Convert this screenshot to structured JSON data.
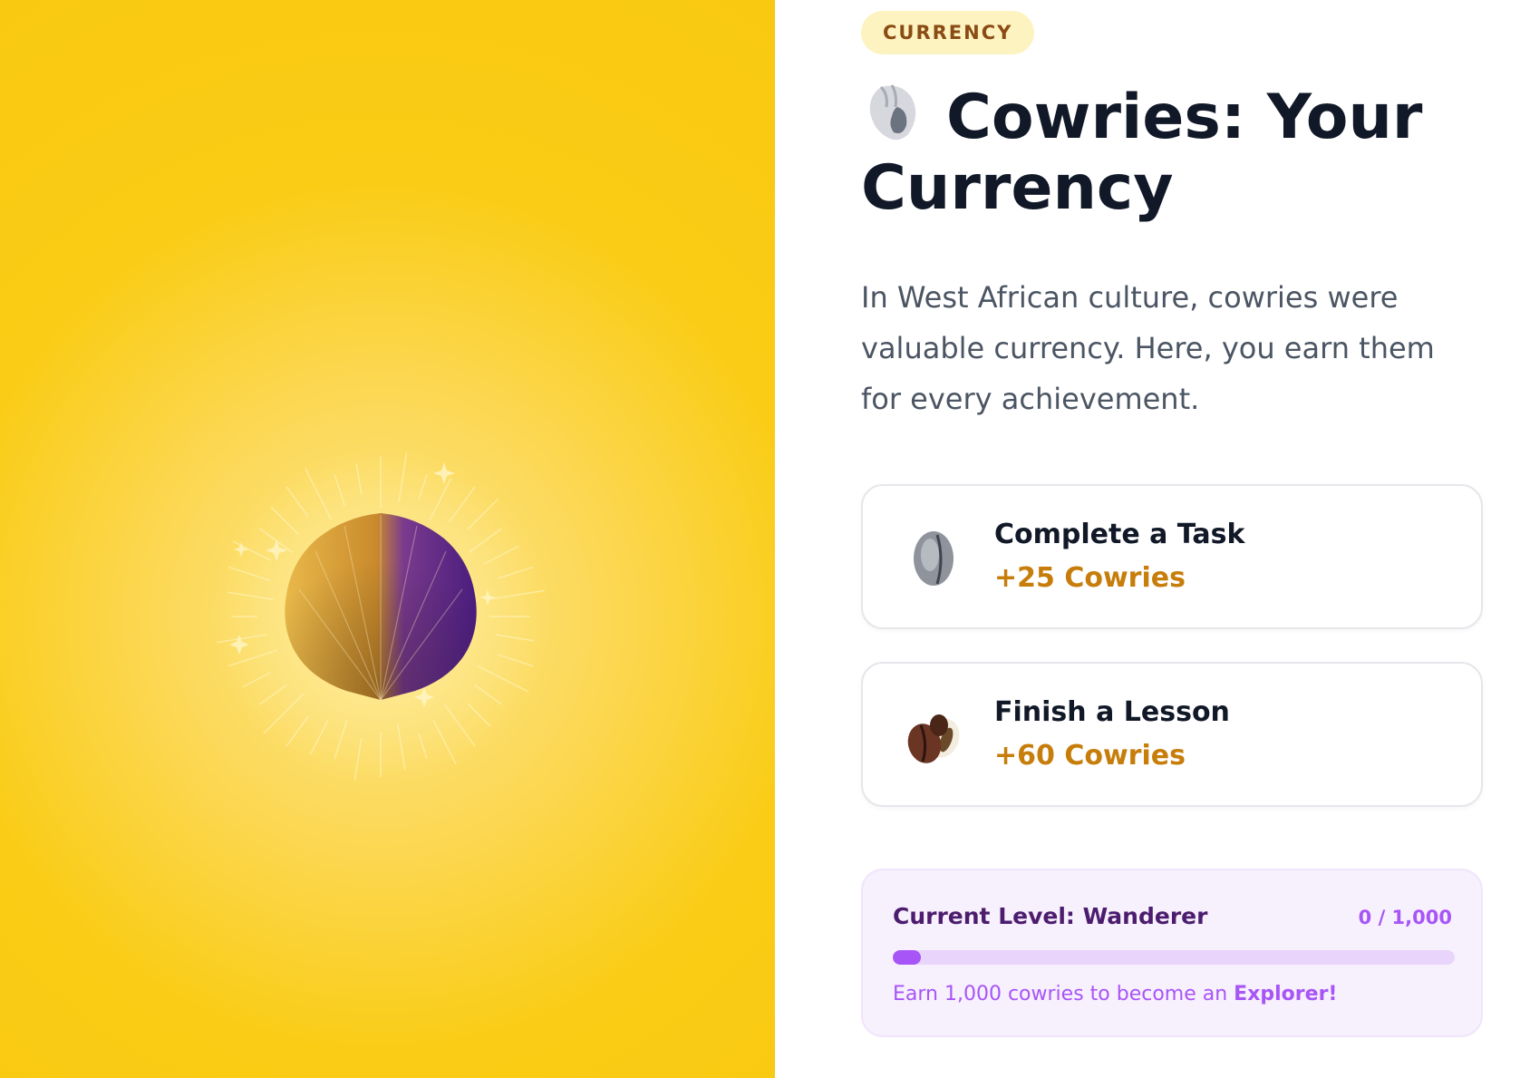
{
  "hero": {
    "image": "scallop-shell-illustration",
    "colors": {
      "background": "#facc15",
      "shell_gold": "#e8b64a",
      "shell_purple": "#5b2590"
    }
  },
  "header": {
    "badge": "CURRENCY",
    "title_icon": "spiral-shell-icon",
    "title": "Cowries: Your Currency"
  },
  "intro": "In West African culture, cowries were valuable currency. Here, you earn them for every achievement.",
  "rewards": [
    {
      "icon": "cowrie-shell-icon",
      "title": "Complete a Task",
      "amount": "+25 Cowries"
    },
    {
      "icon": "cowrie-pair-icon",
      "title": "Finish a Lesson",
      "amount": "+60 Cowries"
    }
  ],
  "level": {
    "label": "Current Level: Wanderer",
    "progress_text": "0 / 1,000",
    "progress_fraction": 0.05,
    "hint_prefix": "Earn 1,000 cowries to become an ",
    "hint_highlight": "Explorer!"
  },
  "colors": {
    "accent_purple": "#a855f7",
    "reward_gold": "#c77d0a",
    "badge_bg": "#fdf3c0"
  }
}
